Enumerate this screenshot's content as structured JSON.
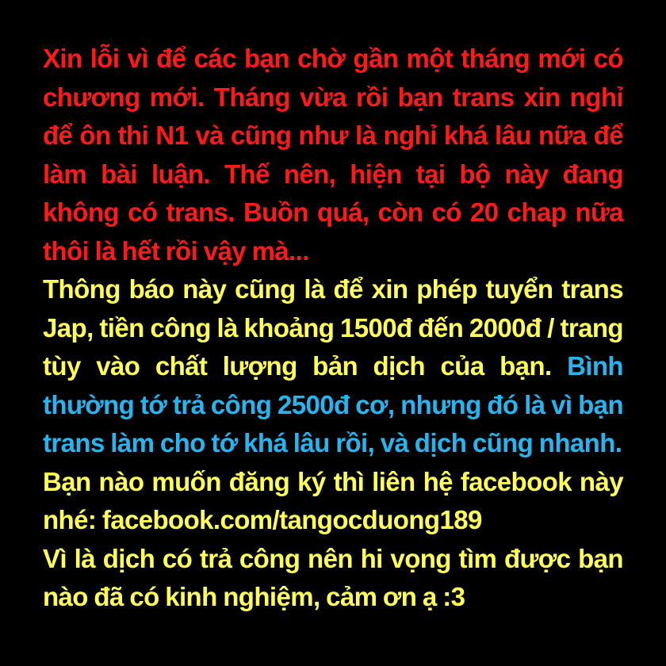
{
  "colors": {
    "background": "#000000",
    "red_text": "#ff1a1a",
    "yellow_text": "#ffff57",
    "cyan_text": "#26b5ef"
  },
  "apology": "Xin lỗi vì để các bạn chờ gần một tháng mới có chương mới. Tháng vừa rồi bạn trans xin nghỉ để ôn thi N1 và cũng như là nghỉ khá lâu nữa để làm bài luận. Thế nên, hiện tại bộ này đang không có trans. Buồn quá, còn có 20 chap nữa thôi là hết rồi vậy mà...",
  "recruit": {
    "intro": "Thông báo này cũng là để xin phép tuyển trans Jap, tiền công là khoảng 1500đ đến 2000đ / trang tùy vào chất lượng bản dịch của bạn. ",
    "note": "Bình thường tớ trả công 2500đ cơ, nhưng đó là vì bạn trans làm cho tớ khá lâu rồi, và dịch cũng nhanh.",
    "contact": "Bạn nào muốn đăng ký thì liên hệ facebook này nhé: facebook.com/tangocduong189",
    "closing": "Vì là dịch có trả công nên hi vọng tìm được bạn nào đã có kinh nghiệm, cảm ơn ạ :3"
  }
}
